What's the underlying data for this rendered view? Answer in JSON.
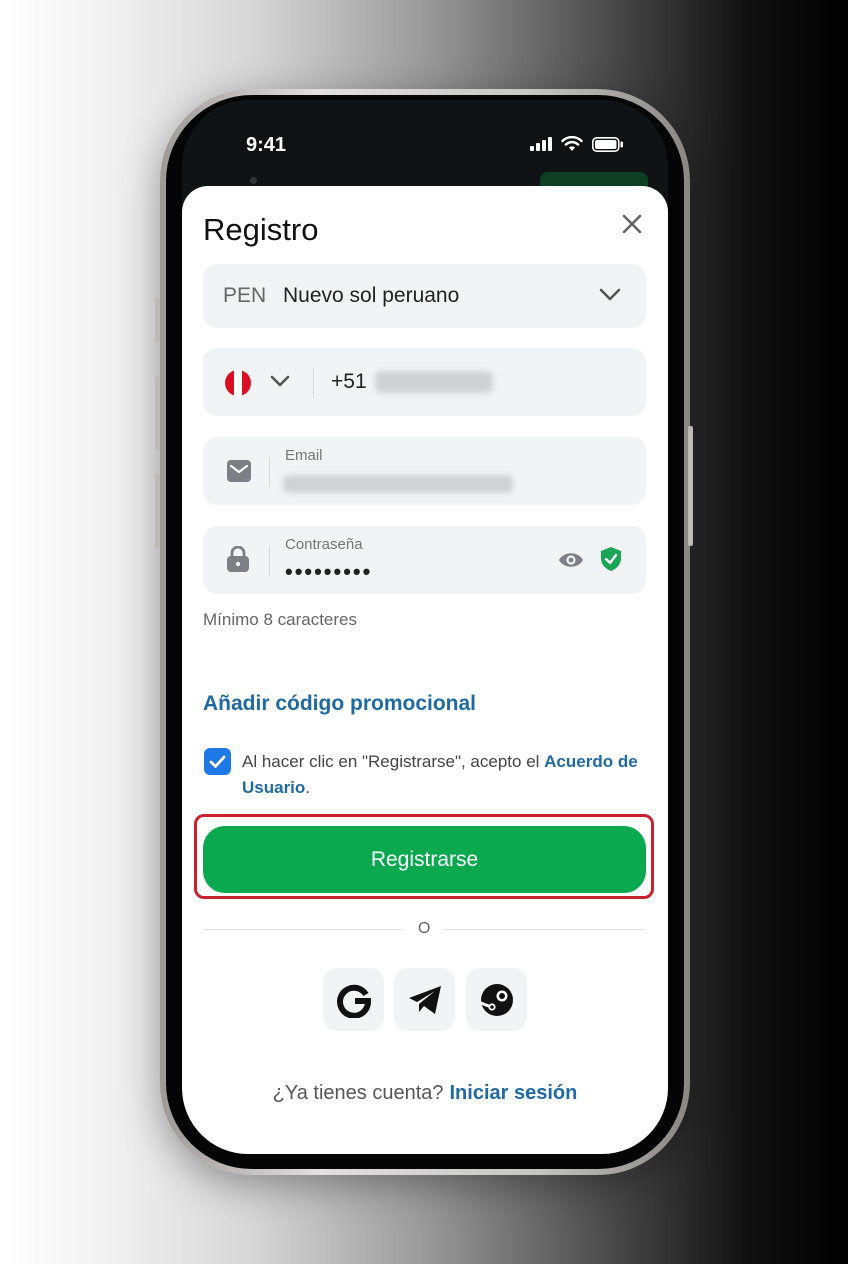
{
  "status_bar": {
    "time": "9:41"
  },
  "sheet": {
    "title": "Registro",
    "currency": {
      "code": "PEN",
      "name": "Nuevo sol peruano"
    },
    "phone": {
      "prefix": "+51"
    },
    "email": {
      "label": "Email"
    },
    "password": {
      "label": "Contraseña",
      "masked_value": "•••••••••",
      "hint": "Mínimo 8 caracteres"
    },
    "promo_link": "Añadir código promocional",
    "terms": {
      "checked": true,
      "text": "Al hacer clic en \"Registrarse\", acepto el ",
      "link": "Acuerdo de Usuario",
      "end": "."
    },
    "register_button": "Registrarse",
    "divider_text": "O",
    "social": [
      "google-icon",
      "telegram-icon",
      "steam-icon"
    ],
    "footer": {
      "question": "¿Ya tienes cuenta?",
      "login_link": "Iniciar sesión"
    }
  },
  "colors": {
    "accent_green": "#0aa84f",
    "link_blue": "#1f6aa3",
    "checkbox_blue": "#1e78e6",
    "highlight_red": "#c8232c",
    "shield_green": "#1aa557"
  }
}
